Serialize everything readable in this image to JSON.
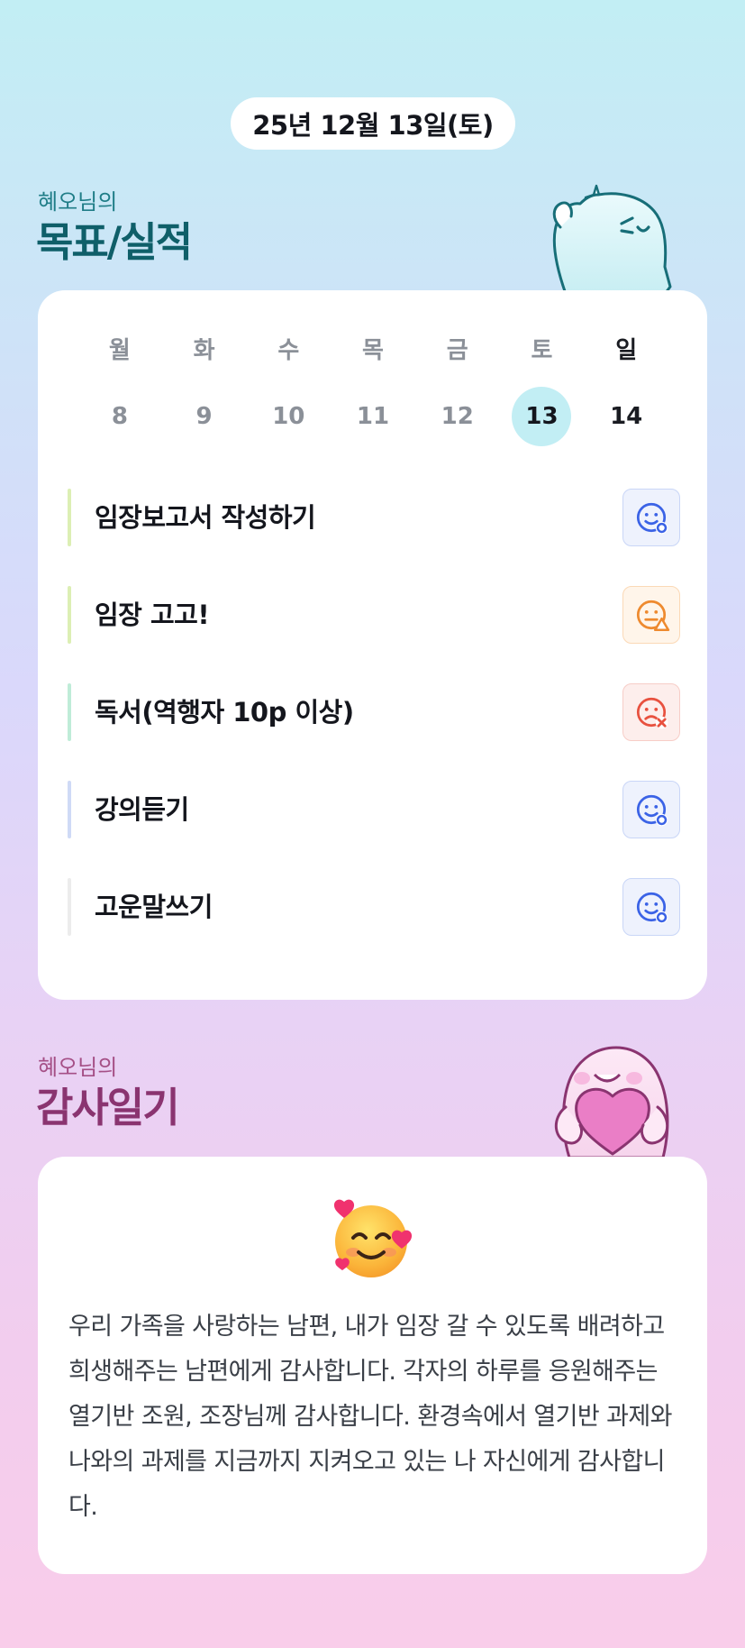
{
  "date_label": "25년 12월 13일(토)",
  "goals_section": {
    "subtitle": "혜오님의",
    "title": "목표/실적",
    "colors": {
      "subtitle": "#1f7d87",
      "title": "#0f5f69"
    }
  },
  "calendar": {
    "weekdays": [
      "월",
      "화",
      "수",
      "목",
      "금",
      "토",
      "일"
    ],
    "dates": [
      "8",
      "9",
      "10",
      "11",
      "12",
      "13",
      "14"
    ],
    "selected_date": "13",
    "selected_color": "#c2eef4"
  },
  "tasks": [
    {
      "label": "임장보고서 작성하기",
      "bar_color": "#dcefb4",
      "status": "done",
      "icon": "smile-check-icon"
    },
    {
      "label": "임장 고고!",
      "bar_color": "#dcefb4",
      "status": "warning",
      "icon": "smile-warning-icon"
    },
    {
      "label": "독서(역행자 10p 이상)",
      "bar_color": "#bfecd8",
      "status": "fail",
      "icon": "sad-x-icon"
    },
    {
      "label": "강의듣기",
      "bar_color": "#cfdaf6",
      "status": "done",
      "icon": "smile-check-icon"
    },
    {
      "label": "고운말쓰기",
      "bar_color": "#ececec",
      "status": "done",
      "icon": "smile-check-icon"
    }
  ],
  "status_colors": {
    "done": {
      "fg": "#3b63e6",
      "bg": "#eef2fd",
      "border": "#c9d6f7"
    },
    "warning": {
      "fg": "#ee8a2f",
      "bg": "#fff5ea",
      "border": "#fbd9b6"
    },
    "fail": {
      "fg": "#e8513f",
      "bg": "#fdeeec",
      "border": "#f7cdc7"
    }
  },
  "diary_section": {
    "subtitle": "혜오님의",
    "title": "감사일기",
    "colors": {
      "subtitle": "#a54f86",
      "title": "#8a3470"
    },
    "emoji": "smiling-face-with-hearts-icon",
    "text": "우리 가족을 사랑하는 남편, 내가 임장 갈 수 있도록 배려하고 희생해주는 남편에게 감사합니다. 각자의 하루를 응원해주는 열기반 조원, 조장님께 감사합니다. 환경속에서 열기반 과제와 나와의 과제를 지금까지 지켜오고 있는 나 자신에게 감사합니다."
  }
}
